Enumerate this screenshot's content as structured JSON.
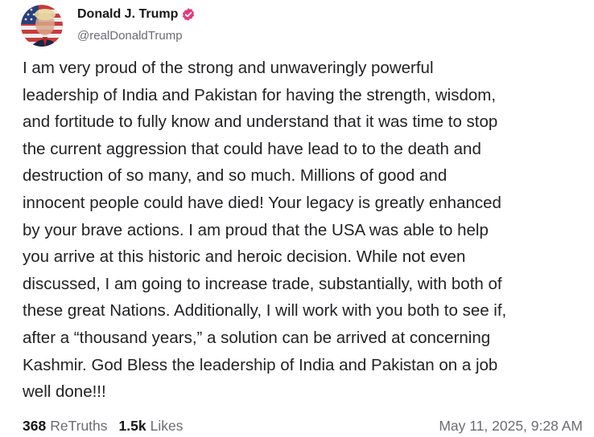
{
  "author": {
    "display_name": "Donald J. Trump",
    "handle": "@realDonaldTrump",
    "verified": true,
    "verified_badge_icon": "verified-badge-icon",
    "verified_badge_color": "#e5397f",
    "avatar_icon": "profile-avatar"
  },
  "post": {
    "lines": [
      "I am very proud of the strong and unwaveringly powerful",
      "leadership of India and Pakistan for having the strength, wisdom,",
      "and fortitude to fully know and understand that it was time to stop",
      "the current aggression that could have lead to to the death and",
      "destruction of so many, and so much. Millions of good and",
      "innocent people could have died! Your legacy is greatly enhanced",
      "by your brave actions. I am proud that the USA was able to help",
      "you arrive at this historic and heroic decision. While not even",
      "discussed, I am going to increase trade, substantially, with both of",
      "these great Nations. Additionally, I will work with you both to see if,",
      "after a “thousand years,” a solution can be arrived at concerning",
      "Kashmir. God Bless the leadership of India and Pakistan on a job",
      "well done!!!"
    ]
  },
  "stats": {
    "retruths_count": "368",
    "retruths_label": "ReTruths",
    "likes_count": "1.5k",
    "likes_label": "Likes"
  },
  "timestamp": "May 11, 2025, 9:28 AM"
}
